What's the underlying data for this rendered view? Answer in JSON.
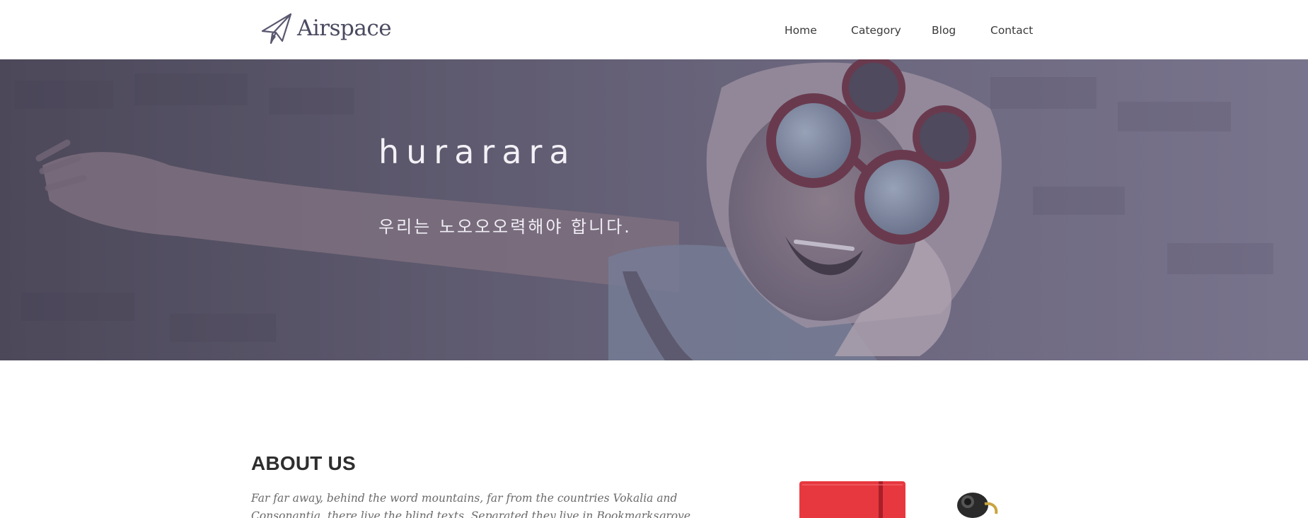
{
  "brand": {
    "name": "Airspace",
    "logo_icon": "paper-plane-icon"
  },
  "nav": {
    "items": [
      {
        "label": "Home"
      },
      {
        "label": "Category"
      },
      {
        "label": "Blog"
      },
      {
        "label": "Contact"
      }
    ]
  },
  "hero": {
    "title": "hurarara",
    "subtitle": "우리는 노오오오력해야 합니다."
  },
  "about": {
    "title": "ABOUT US",
    "text": "Far far away, behind the word mountains, far from the countries Vokalia and Consonantia, there live the blind texts. Separated they live in Bookmarksgrove right at the coast of the"
  },
  "colors": {
    "header_bg": "#ffffff",
    "hero_tint": "#6b6680",
    "hero_text": "#f3f1f6",
    "heading": "#2e2e2e",
    "body_text": "#6a6a6a",
    "notebook_red": "#e8383f"
  }
}
